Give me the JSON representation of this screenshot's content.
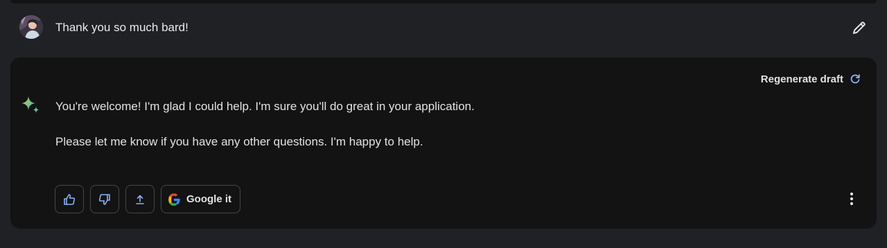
{
  "user_message": {
    "text": "Thank you so much bard!",
    "avatar_icon": "user-avatar",
    "edit_icon": "pencil-icon"
  },
  "response": {
    "regenerate_label": "Regenerate draft",
    "regenerate_icon": "refresh-icon",
    "paragraphs": [
      "You're welcome! I'm glad I could help. I'm sure you'll do great in your application.",
      "Please let me know if you have any other questions. I'm happy to help."
    ],
    "actions": {
      "like_icon": "thumbs-up-icon",
      "dislike_icon": "thumbs-down-icon",
      "share_icon": "share-upload-icon",
      "google_label": "Google it",
      "google_icon": "google-g-icon",
      "more_icon": "more-vertical-icon"
    }
  },
  "colors": {
    "background": "#202124",
    "card": "#131314",
    "text": "#e3e3e3",
    "accent_blue": "#8ab4f8",
    "border": "#444746"
  }
}
